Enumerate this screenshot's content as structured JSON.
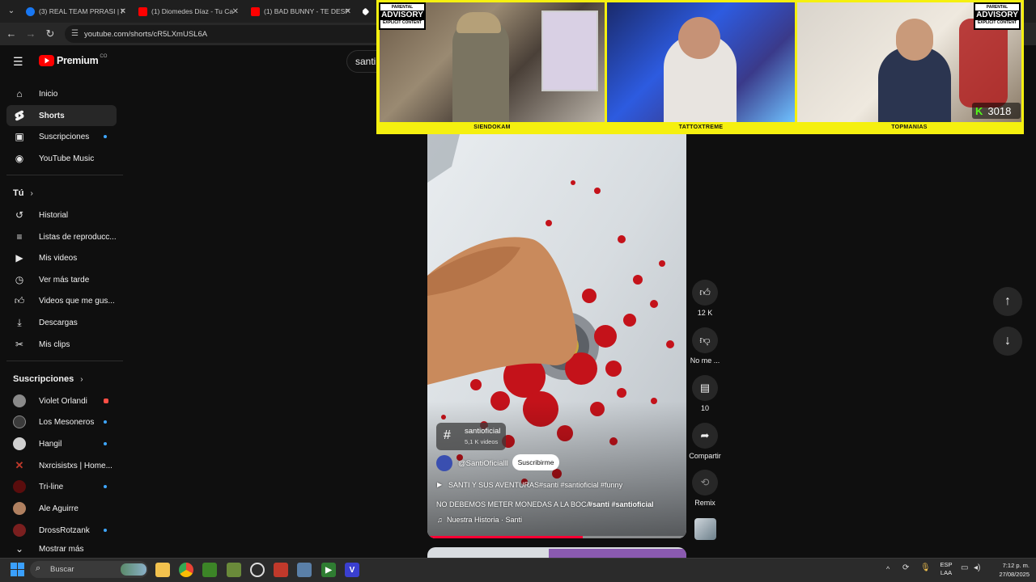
{
  "browser": {
    "tabs": [
      {
        "title": "(3) REAL TEAM PRRASI | F",
        "color": "#1877f2"
      },
      {
        "title": "(1) Diomedes Díaz - Tu Ca",
        "color": "#ff0000"
      },
      {
        "title": "(1) BAD BUNNY - TE DESP",
        "color": "#ff0000"
      }
    ],
    "url": "youtube.com/shorts/cR5LXmUSL6A"
  },
  "header": {
    "logo_text": "Premium",
    "country_code": "CO",
    "search_value": "santi"
  },
  "sidebar": {
    "main_items": [
      {
        "label": "Inicio",
        "icon": "home-icon"
      },
      {
        "label": "Shorts",
        "icon": "shorts-icon"
      },
      {
        "label": "Suscripciones",
        "icon": "subscriptions-icon"
      },
      {
        "label": "YouTube Music",
        "icon": "youtube-music-icon"
      }
    ],
    "you_title": "Tú",
    "you_items": [
      {
        "label": "Historial",
        "icon": "history-icon"
      },
      {
        "label": "Listas de reproducc...",
        "icon": "playlists-icon"
      },
      {
        "label": "Mis videos",
        "icon": "my-videos-icon"
      },
      {
        "label": "Ver más tarde",
        "icon": "watch-later-icon"
      },
      {
        "label": "Videos que me gus...",
        "icon": "liked-videos-icon"
      },
      {
        "label": "Descargas",
        "icon": "downloads-icon"
      },
      {
        "label": "Mis clips",
        "icon": "clips-icon"
      }
    ],
    "subs_title": "Suscripciones",
    "subscriptions": [
      {
        "label": "Violet Orlandi",
        "color": "#8a8a8a"
      },
      {
        "label": "Los Mesoneros",
        "color": "#3b3b3b"
      },
      {
        "label": "Hangil",
        "color": "#d0d0d0"
      },
      {
        "label": "Nxrcisistxs | Home...",
        "color": "#c0392b"
      },
      {
        "label": "Tri-line",
        "color": "#5a0d0d"
      },
      {
        "label": "Ale Aguirre",
        "color": "#b08060"
      },
      {
        "label": "DrossRotzank",
        "color": "#7a1f1f"
      }
    ],
    "show_more": "Mostrar más"
  },
  "overlay": {
    "cams": [
      "SIENDOKAM",
      "TATTOXTREME",
      "TOPMANIAS"
    ],
    "advisory_top": "PARENTAL",
    "advisory_mid": "ADVISORY",
    "advisory_bottom": "EXPLICIT CONTENT",
    "kick_count": "3018"
  },
  "video": {
    "hashtag_name": "santioficial",
    "hashtag_videos": "5,1 K videos",
    "channel": "@SantiOficialll",
    "subscribe": "Suscribirme",
    "playlist": "SANTI Y SUS AVENTURAS",
    "playlist_tags": "#santi #santioficial #funny",
    "title": "NO DEBEMOS METER MONEDAS A LA BOCA",
    "title_tags": "#santi #santioficial",
    "audio": "Nuestra Historia · Santi",
    "progress": 0.6
  },
  "actions": {
    "likes": "12 K",
    "dislike": "No me ...",
    "comments": "10",
    "share": "Compartir",
    "remix": "Remix"
  },
  "taskbar": {
    "search_placeholder": "Buscar",
    "lang_top": "ESP",
    "lang_bottom": "LAA",
    "time": "7:12 p. m.",
    "date": "27/08/2025"
  }
}
